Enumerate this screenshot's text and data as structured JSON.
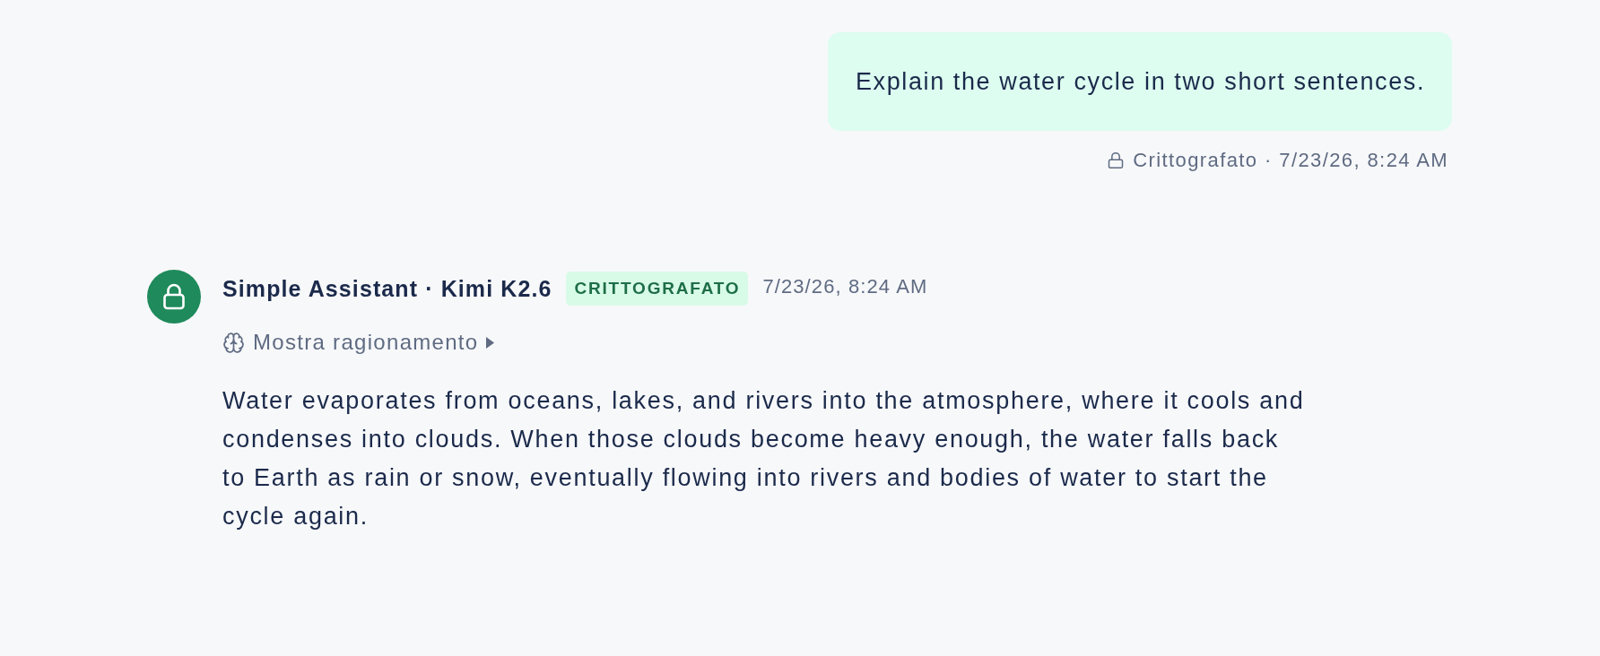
{
  "user_message": {
    "text": "Explain the water cycle in two short sentences.",
    "meta": "Crittografato · 7/23/26, 8:24 AM"
  },
  "assistant_message": {
    "sender": "Simple Assistant · Kimi K2.6",
    "badge": "CRITTOGRAFATO",
    "timestamp": "7/23/26, 8:24 AM",
    "reasoning_toggle": {
      "label": "Mostra ragionamento",
      "expanded": false
    },
    "text": "Water evaporates from oceans, lakes, and rivers into the atmosphere, where it cools and condenses into clouds. When those clouds become heavy enough, the water falls back to Earth as rain or snow, eventually flowing into rivers and bodies of water to start the cycle again."
  }
}
